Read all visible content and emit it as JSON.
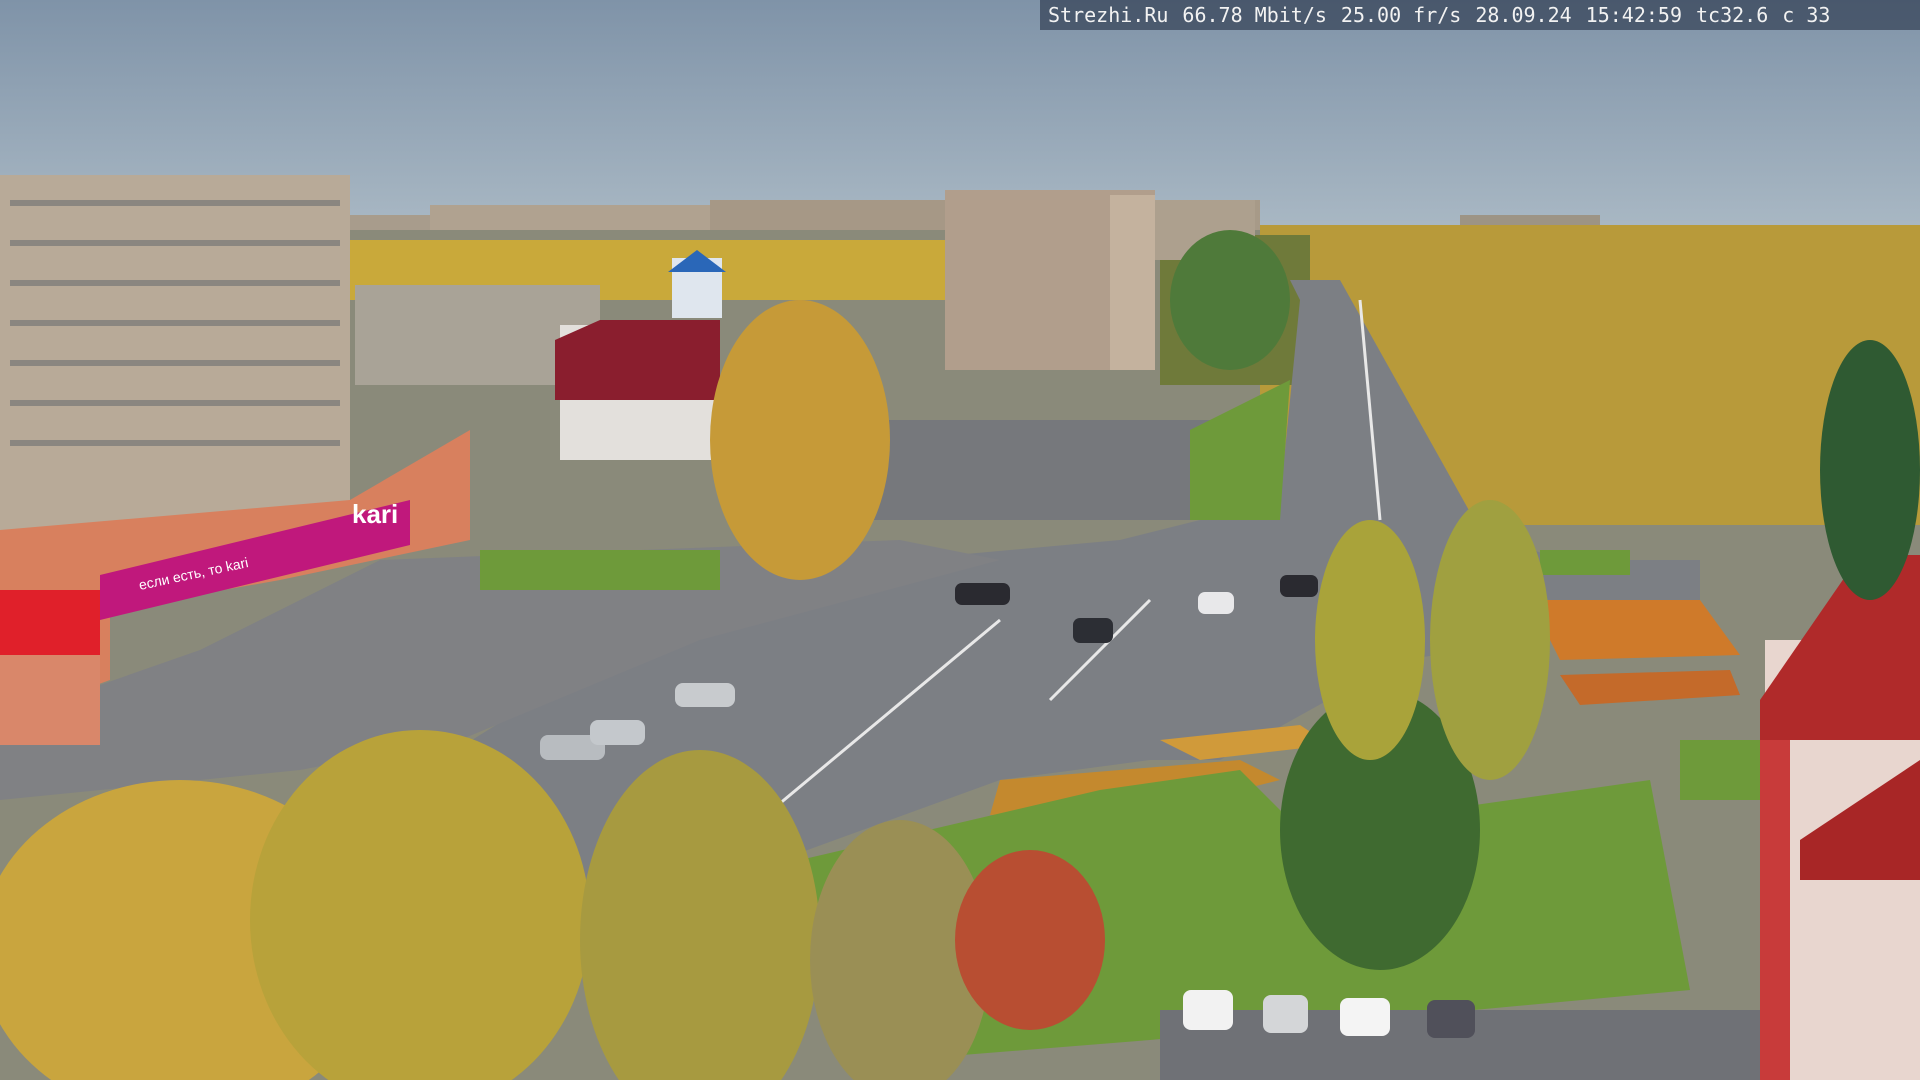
{
  "overlay": {
    "site": "Strezhi.Ru",
    "bitrate": "66.78 Mbit/s",
    "framerate": "25.00 fr/s",
    "date": "28.09.24",
    "time": "15:42:59",
    "temp": "tc32.6",
    "channel": "c 33"
  },
  "signs": {
    "kari_logo": "kari",
    "kari_slogan": "если есть, то kari"
  },
  "colors": {
    "sky": "#8fa3b5",
    "road": "#7c7f84",
    "grass": "#6e9a3a",
    "foliage": "#c8a23a",
    "kari_magenta": "#c0187c",
    "brick_red": "#b02a2a"
  }
}
